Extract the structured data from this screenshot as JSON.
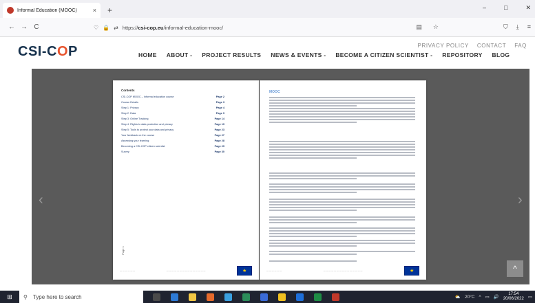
{
  "browser": {
    "tab_title": "Informal Education (MOOC)",
    "tab_close": "×",
    "new_tab": "+",
    "window_controls": [
      "–",
      "□",
      "✕"
    ],
    "nav_icons": [
      "←",
      "→",
      "C"
    ],
    "url_prefix": "https://",
    "url_host": "csi-cop.eu",
    "url_path": "/informal-education-mooc/",
    "url_icons": [
      "▤",
      "☆"
    ],
    "toolbar_icons": [
      "⛉",
      "⤓",
      "≡"
    ]
  },
  "site": {
    "logo_pre": "CSI-C",
    "logo_o": "O",
    "logo_post": "P",
    "util_nav": [
      "PRIVACY POLICY",
      "CONTACT",
      "FAQ"
    ],
    "main_nav": [
      "HOME",
      "ABOUT -",
      "PROJECT RESULTS",
      "NEWS & EVENTS -",
      "BECOME A CITIZEN SCIENTIST -",
      "REPOSITORY",
      "BLOG"
    ]
  },
  "viewer": {
    "toc_title": "Contents",
    "toc": [
      {
        "label": "CSI-COP MOOC – Informal education course",
        "page": "Page 2"
      },
      {
        "label": "Course Details",
        "page": "Page 3"
      },
      {
        "label": "Step 1: Privacy",
        "page": "Page 4"
      },
      {
        "label": "Step 2: Data",
        "page": "Page 9"
      },
      {
        "label": "Step 3: Online Tracking",
        "page": "Page 14"
      },
      {
        "label": "Step 4: Rights to data protection and privacy",
        "page": "Page 19"
      },
      {
        "label": "Step 5: Tools to protect your data and privacy",
        "page": "Page 23"
      },
      {
        "label": "Your feedback on the course",
        "page": "Page 27"
      },
      {
        "label": "Assessing your learning",
        "page": "Page 28"
      },
      {
        "label": "Becoming a CSI-COP citizen scientist",
        "page": "Page 29"
      },
      {
        "label": "Survey",
        "page": "Page 30"
      }
    ],
    "right_page_title": "MOOC",
    "prev_arrow": "‹",
    "next_arrow": "›",
    "scroll_top": "^"
  },
  "taskbar": {
    "start_icon": "⊞",
    "search_icon": "⚲",
    "search_placeholder": "Type here to search",
    "app_colors": [
      "#4a4a4a",
      "#2d7ad6",
      "#f2c744",
      "#e66a2c",
      "#3aa0e0",
      "#2b8c5a",
      "#3b6bd8",
      "#f0c020",
      "#1e6fd9",
      "#1e8c45",
      "#c0392b"
    ],
    "temperature": "20°C",
    "time": "17:54",
    "date": "20/06/2022",
    "tray_icons": [
      "⛅",
      "^",
      "▭",
      "🔊"
    ],
    "notification_icon": "▭"
  }
}
